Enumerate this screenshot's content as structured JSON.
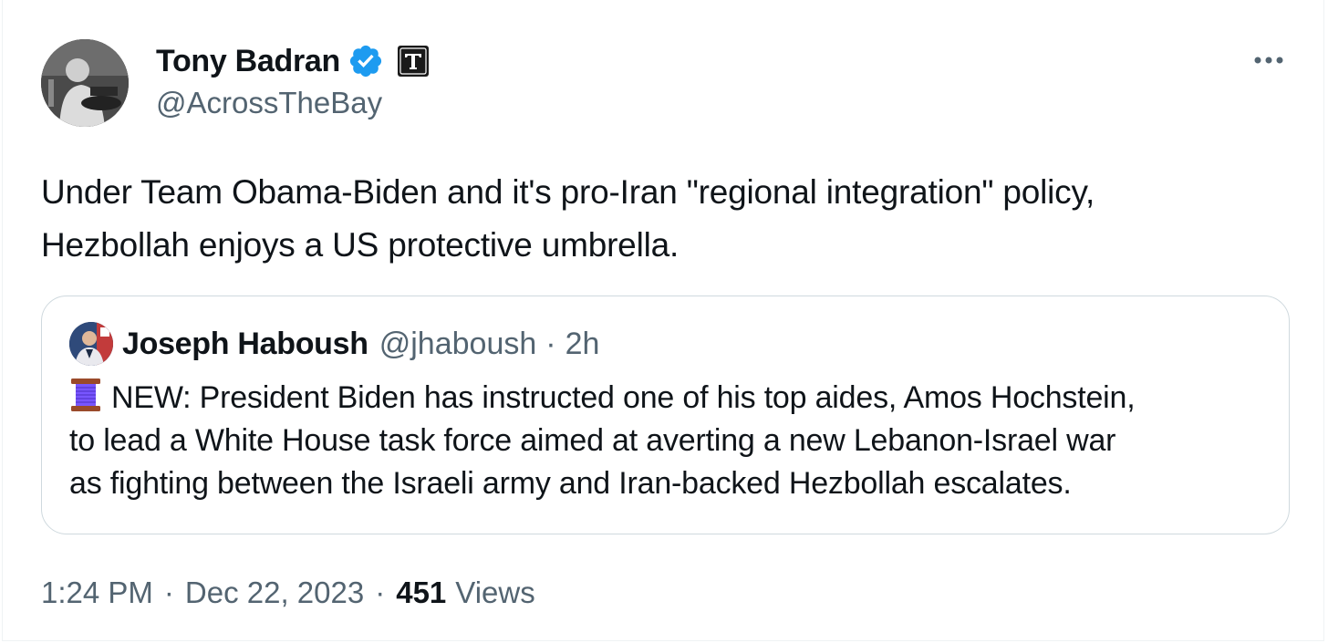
{
  "author": {
    "name": "Tony Badran",
    "handle": "@AcrossTheBay"
  },
  "tweet": {
    "text_line1": "Under Team Obama-Biden and it's pro-Iran \"regional integration\" policy,",
    "text_line2": "Hezbollah enjoys a US protective umbrella."
  },
  "quoted": {
    "name": "Joseph Haboush",
    "handle": "@jhaboush",
    "separator": "·",
    "time": "2h",
    "line1": "NEW: President Biden has instructed one of his top aides, Amos Hochstein,",
    "line2": "to lead a White House task force aimed at averting a new Lebanon-Israel war",
    "line3": "as fighting between the Israeli army and Iran-backed Hezbollah escalates."
  },
  "meta": {
    "time": "1:24 PM",
    "sep1": "·",
    "date": "Dec 22, 2023",
    "sep2": "·",
    "views_count": "451",
    "views_label": "Views"
  },
  "icons": {
    "verified": "verified-badge-icon",
    "affiliation": "affiliation-t-icon",
    "more": "more-dots-icon",
    "spool": "thread-spool-icon"
  },
  "colors": {
    "text_primary": "#0f1419",
    "text_secondary": "#536471",
    "verified_blue": "#1d9bf0",
    "border": "#cfd9de",
    "spool": "#7856ff"
  }
}
